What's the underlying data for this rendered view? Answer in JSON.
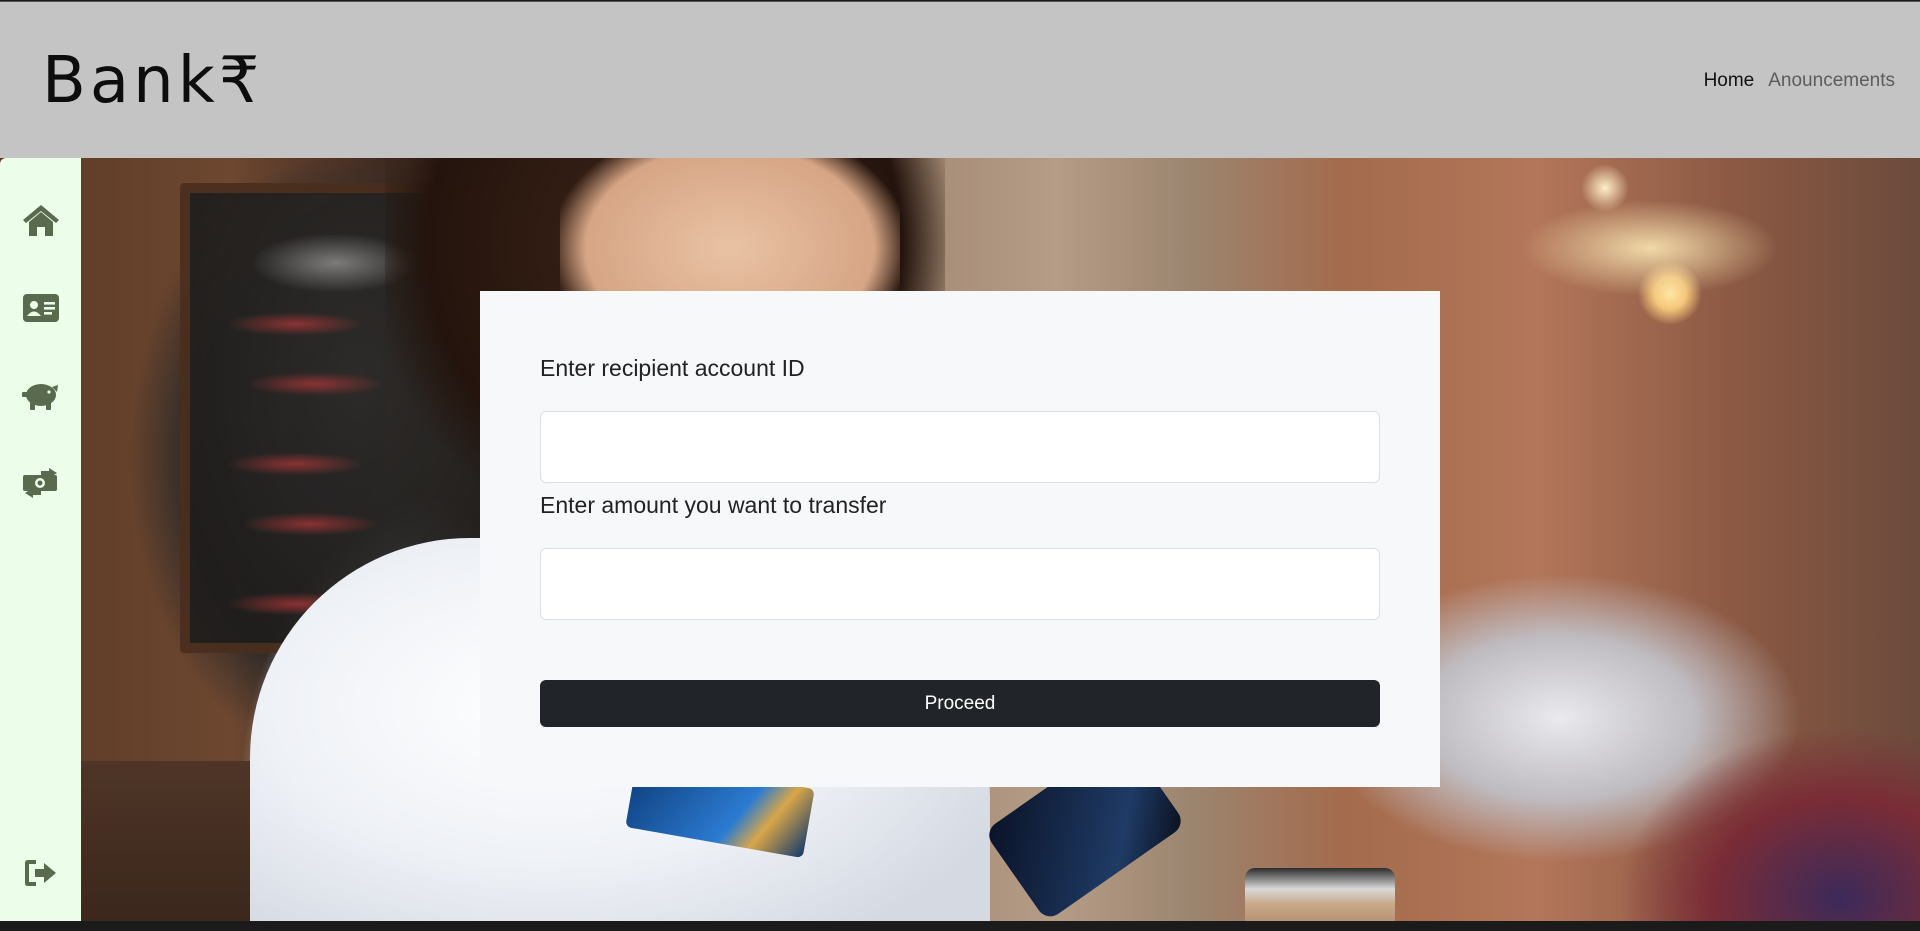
{
  "header": {
    "brand": "Bank₹",
    "nav": [
      {
        "label": "Home",
        "active": true
      },
      {
        "label": "Anouncements",
        "active": false
      }
    ]
  },
  "sidebar": {
    "items": [
      {
        "icon": "home-icon"
      },
      {
        "icon": "id-card-icon"
      },
      {
        "icon": "piggy-bank-icon"
      },
      {
        "icon": "money-transfer-icon"
      }
    ],
    "footer_icon": "sign-out-icon",
    "icon_color": "#596a4f",
    "background": "#ecfde9"
  },
  "form": {
    "recipient_label": "Enter recipient account ID",
    "recipient_value": "",
    "recipient_placeholder": "",
    "amount_label": "Enter amount you want to transfer",
    "amount_value": "",
    "amount_placeholder": "",
    "submit_label": "Proceed"
  },
  "colors": {
    "header_bg": "#c4c4c4",
    "button_bg": "#212529",
    "card_bg": "#f7f8fa"
  }
}
